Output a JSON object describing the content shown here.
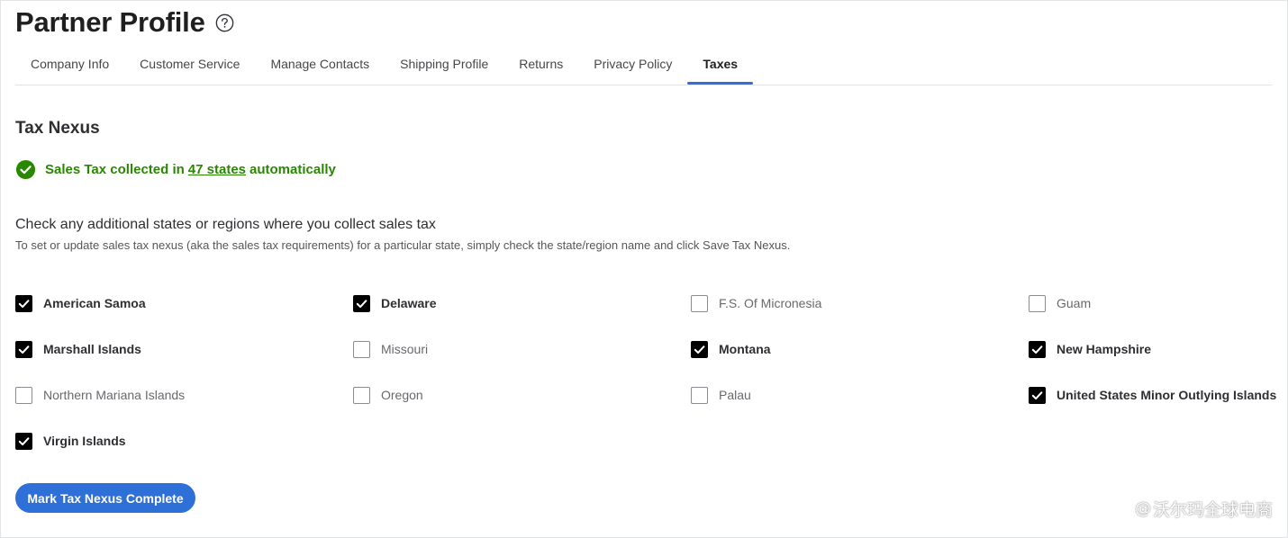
{
  "header": {
    "title": "Partner Profile",
    "help_icon": "help-circle-icon"
  },
  "tabs": [
    {
      "label": "Company Info",
      "active": false
    },
    {
      "label": "Customer Service",
      "active": false
    },
    {
      "label": "Manage Contacts",
      "active": false
    },
    {
      "label": "Shipping Profile",
      "active": false
    },
    {
      "label": "Returns",
      "active": false
    },
    {
      "label": "Privacy Policy",
      "active": false
    },
    {
      "label": "Taxes",
      "active": true
    }
  ],
  "tax_nexus": {
    "title": "Tax Nexus",
    "status": {
      "icon": "check-circle-icon",
      "prefix": "Sales Tax collected in",
      "link": "47 states",
      "suffix": "automatically",
      "color": "#2a8703"
    },
    "instructions_title": "Check any additional states or regions where you collect sales tax",
    "instructions_sub": "To set or update sales tax nexus (aka the sales tax requirements) for a particular state, simply check the state/region name and click Save Tax Nexus.",
    "options": [
      {
        "label": "American Samoa",
        "checked": true
      },
      {
        "label": "Delaware",
        "checked": true
      },
      {
        "label": "F.S. Of Micronesia",
        "checked": false
      },
      {
        "label": "Guam",
        "checked": false
      },
      {
        "label": "Marshall Islands",
        "checked": true
      },
      {
        "label": "Missouri",
        "checked": false
      },
      {
        "label": "Montana",
        "checked": true
      },
      {
        "label": "New Hampshire",
        "checked": true
      },
      {
        "label": "Northern Mariana Islands",
        "checked": false
      },
      {
        "label": "Oregon",
        "checked": false
      },
      {
        "label": "Palau",
        "checked": false
      },
      {
        "label": "United States Minor Outlying Islands",
        "checked": true
      },
      {
        "label": "Virgin Islands",
        "checked": true
      }
    ],
    "button_label": "Mark Tax Nexus Complete"
  },
  "watermark": {
    "text": "沃尔玛全球电商",
    "prefix": "@"
  },
  "colors": {
    "accent": "#2f6fd8",
    "success": "#2a8703",
    "checkbox_checked": "#000000"
  }
}
